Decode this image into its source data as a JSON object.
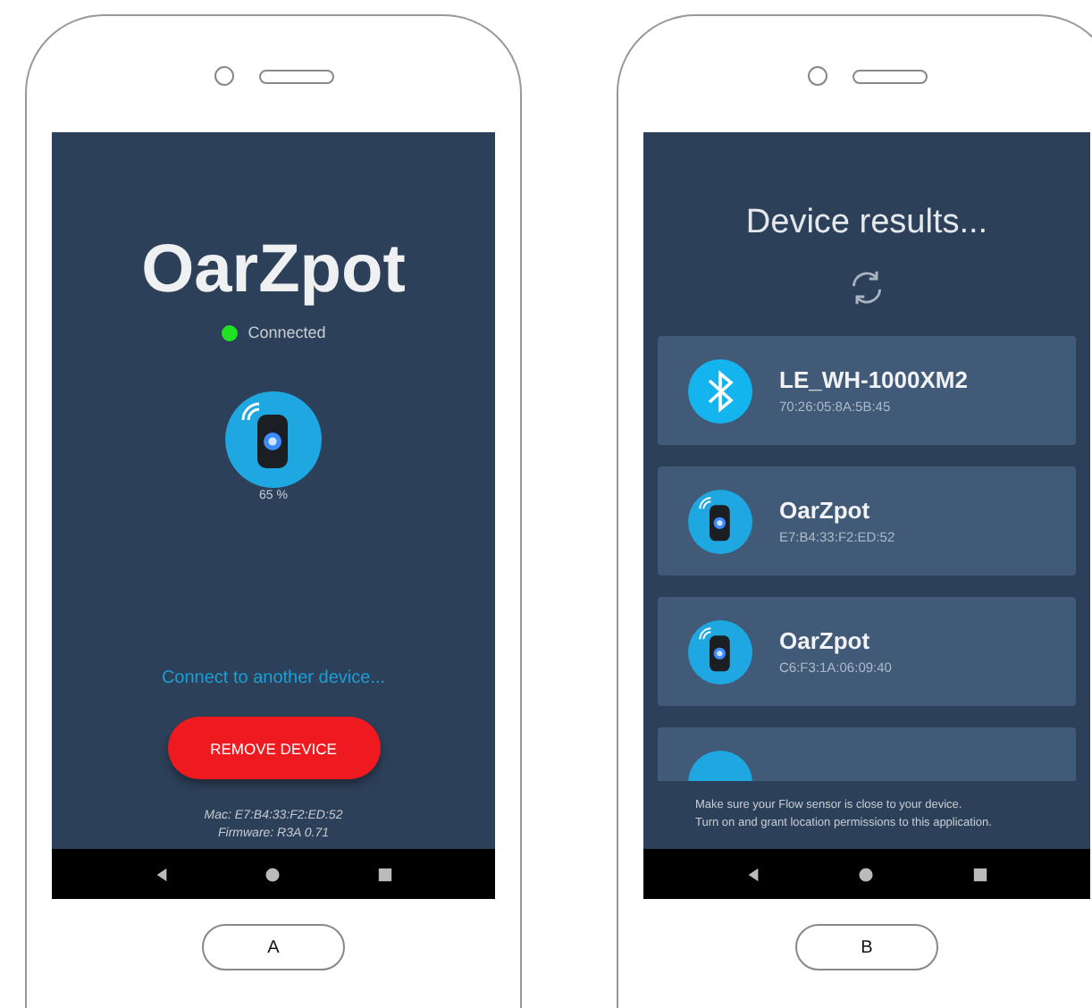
{
  "phones": [
    {
      "kind": "device",
      "label": "A",
      "title": "OarZpot",
      "status": "Connected",
      "connected": true,
      "battery": "65 %",
      "link": "Connect to another device...",
      "button": "REMOVE DEVICE",
      "mac": "Mac: E7:B4:33:F2:ED:52",
      "firmware": "Firmware: R3A 0.71"
    },
    {
      "kind": "results",
      "label": "B",
      "heading": "Device results...",
      "devices": [
        {
          "kind": "bluetooth",
          "name": "LE_WH-1000XM2",
          "address": "70:26:05:8A:5B:45"
        },
        {
          "kind": "sensor",
          "name": "OarZpot",
          "address": "E7:B4:33:F2:ED:52"
        },
        {
          "kind": "sensor",
          "name": "OarZpot",
          "address": "C6:F3:1A:06:09:40"
        }
      ],
      "more_below": true,
      "hint_lines": [
        "Make sure your Flow sensor is close to your device.",
        "Turn on and grant location permissions to this application."
      ]
    }
  ]
}
